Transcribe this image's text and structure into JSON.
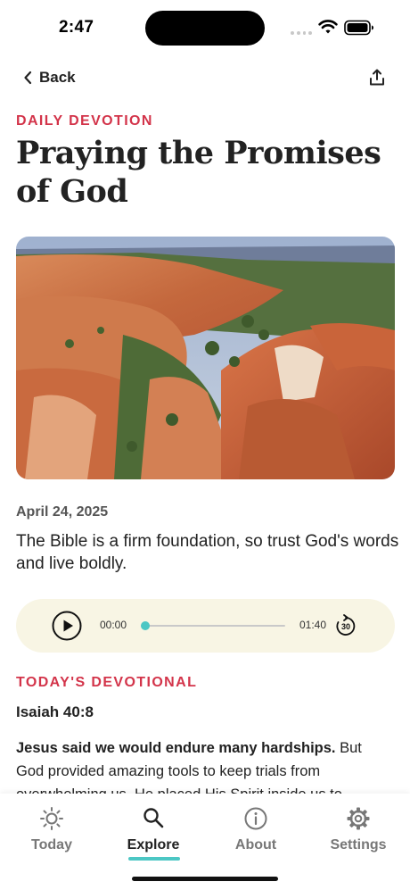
{
  "status_bar": {
    "time": "2:47"
  },
  "nav": {
    "back_label": "Back"
  },
  "article": {
    "eyebrow": "DAILY DEVOTION",
    "title": "Praying the Promises of God",
    "date": "April 24, 2025",
    "summary": "The Bible is a firm foundation, so trust God's words and live boldly."
  },
  "player": {
    "current_time": "00:00",
    "total_time": "01:40",
    "progress": 0.0,
    "skip_seconds": "30"
  },
  "devotional": {
    "section_label": "TODAY'S DEVOTIONAL",
    "reference": "Isaiah 40:8",
    "lead_bold": "Jesus said we would endure many hardships.",
    "lead_rest": " But God provided amazing tools to keep trials from overwhelming us. He placed His Spirit inside us to"
  },
  "tabs": [
    {
      "label": "Today",
      "icon": "sun-icon"
    },
    {
      "label": "Explore",
      "icon": "search-icon"
    },
    {
      "label": "About",
      "icon": "info-icon"
    },
    {
      "label": "Settings",
      "icon": "gear-icon"
    }
  ],
  "active_tab": "Explore",
  "colors": {
    "accent": "#d3344a",
    "teal": "#4cc7c4",
    "player_bg": "#f8f5e4"
  }
}
